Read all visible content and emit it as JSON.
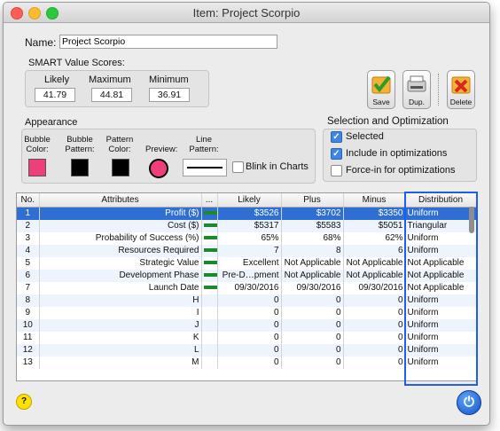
{
  "window": {
    "title": "Item: Project Scorpio"
  },
  "name": {
    "label": "Name:",
    "value": "Project Scorpio"
  },
  "smart": {
    "title": "SMART Value Scores:",
    "likely_label": "Likely",
    "likely_value": "41.79",
    "maximum_label": "Maximum",
    "maximum_value": "44.81",
    "minimum_label": "Minimum",
    "minimum_value": "36.91"
  },
  "buttons": {
    "save": "Save",
    "dup": "Dup.",
    "delete": "Delete"
  },
  "appearance": {
    "title": "Appearance",
    "bubble_color_label": "Bubble Color:",
    "bubble_pattern_label": "Bubble Pattern:",
    "pattern_color_label": "Pattern Color:",
    "preview_label": "Preview:",
    "line_pattern_label": "Line Pattern:",
    "blink_label": "Blink in Charts",
    "bubble_color": "#ef3f7a",
    "pattern_color": "#000000"
  },
  "selection": {
    "title": "Selection and Optimization",
    "selected_label": "Selected",
    "selected": true,
    "include_label": "Include in optimizations",
    "include": true,
    "force_label": "Force-in for optimizations",
    "force": false
  },
  "table": {
    "headers": [
      "No.",
      "Attributes",
      "...",
      "Likely",
      "Plus",
      "Minus",
      "Distribution"
    ],
    "rows": [
      {
        "no": "1",
        "attr": "Profit ($)",
        "likely": "$3526",
        "plus": "$3702",
        "minus": "$3350",
        "dist": "Uniform"
      },
      {
        "no": "2",
        "attr": "Cost ($)",
        "likely": "$5317",
        "plus": "$5583",
        "minus": "$5051",
        "dist": "Triangular"
      },
      {
        "no": "3",
        "attr": "Probability of Success (%)",
        "likely": "65%",
        "plus": "68%",
        "minus": "62%",
        "dist": "Uniform"
      },
      {
        "no": "4",
        "attr": "Resources Required",
        "likely": "7",
        "plus": "8",
        "minus": "6",
        "dist": "Uniform"
      },
      {
        "no": "5",
        "attr": "Strategic Value",
        "likely": "Excellent",
        "plus": "Not Applicable",
        "minus": "Not Applicable",
        "dist": "Not Applicable"
      },
      {
        "no": "6",
        "attr": "Development Phase",
        "likely": "Pre-D…pment",
        "plus": "Not Applicable",
        "minus": "Not Applicable",
        "dist": "Not Applicable"
      },
      {
        "no": "7",
        "attr": "Launch Date",
        "likely": "09/30/2016",
        "plus": "09/30/2016",
        "minus": "09/30/2016",
        "dist": "Not Applicable"
      },
      {
        "no": "8",
        "attr": "H",
        "likely": "0",
        "plus": "0",
        "minus": "0",
        "dist": "Uniform"
      },
      {
        "no": "9",
        "attr": "I",
        "likely": "0",
        "plus": "0",
        "minus": "0",
        "dist": "Uniform"
      },
      {
        "no": "10",
        "attr": "J",
        "likely": "0",
        "plus": "0",
        "minus": "0",
        "dist": "Uniform"
      },
      {
        "no": "11",
        "attr": "K",
        "likely": "0",
        "plus": "0",
        "minus": "0",
        "dist": "Uniform"
      },
      {
        "no": "12",
        "attr": "L",
        "likely": "0",
        "plus": "0",
        "minus": "0",
        "dist": "Uniform"
      },
      {
        "no": "13",
        "attr": "M",
        "likely": "0",
        "plus": "0",
        "minus": "0",
        "dist": "Uniform"
      }
    ]
  },
  "footer": {
    "help": "?",
    "power": "⏻"
  }
}
